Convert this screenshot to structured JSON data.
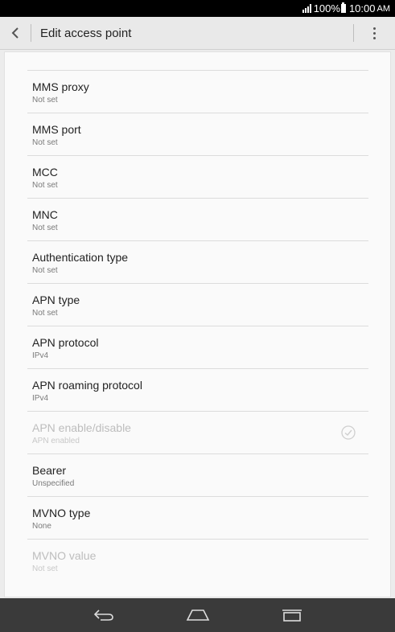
{
  "status_bar": {
    "battery": "100%",
    "time": "10:00",
    "ampm": "AM"
  },
  "action_bar": {
    "title": "Edit access point"
  },
  "settings": [
    {
      "label": "MMS proxy",
      "value": "Not set",
      "enabled": true
    },
    {
      "label": "MMS port",
      "value": "Not set",
      "enabled": true
    },
    {
      "label": "MCC",
      "value": "Not set",
      "enabled": true
    },
    {
      "label": "MNC",
      "value": "Not set",
      "enabled": true
    },
    {
      "label": "Authentication type",
      "value": "Not set",
      "enabled": true
    },
    {
      "label": "APN type",
      "value": "Not set",
      "enabled": true
    },
    {
      "label": "APN protocol",
      "value": "IPv4",
      "enabled": true
    },
    {
      "label": "APN roaming protocol",
      "value": "IPv4",
      "enabled": true
    },
    {
      "label": "APN enable/disable",
      "value": "APN enabled",
      "enabled": false,
      "checked": true
    },
    {
      "label": "Bearer",
      "value": "Unspecified",
      "enabled": true
    },
    {
      "label": "MVNO type",
      "value": "None",
      "enabled": true
    },
    {
      "label": "MVNO value",
      "value": "Not set",
      "enabled": false
    }
  ],
  "icons": {
    "back": "back-arrow-icon",
    "overflow": "overflow-menu-icon",
    "nav_back": "nav-back-icon",
    "nav_home": "nav-home-icon",
    "nav_recents": "nav-recents-icon",
    "check": "check-circle-icon"
  }
}
